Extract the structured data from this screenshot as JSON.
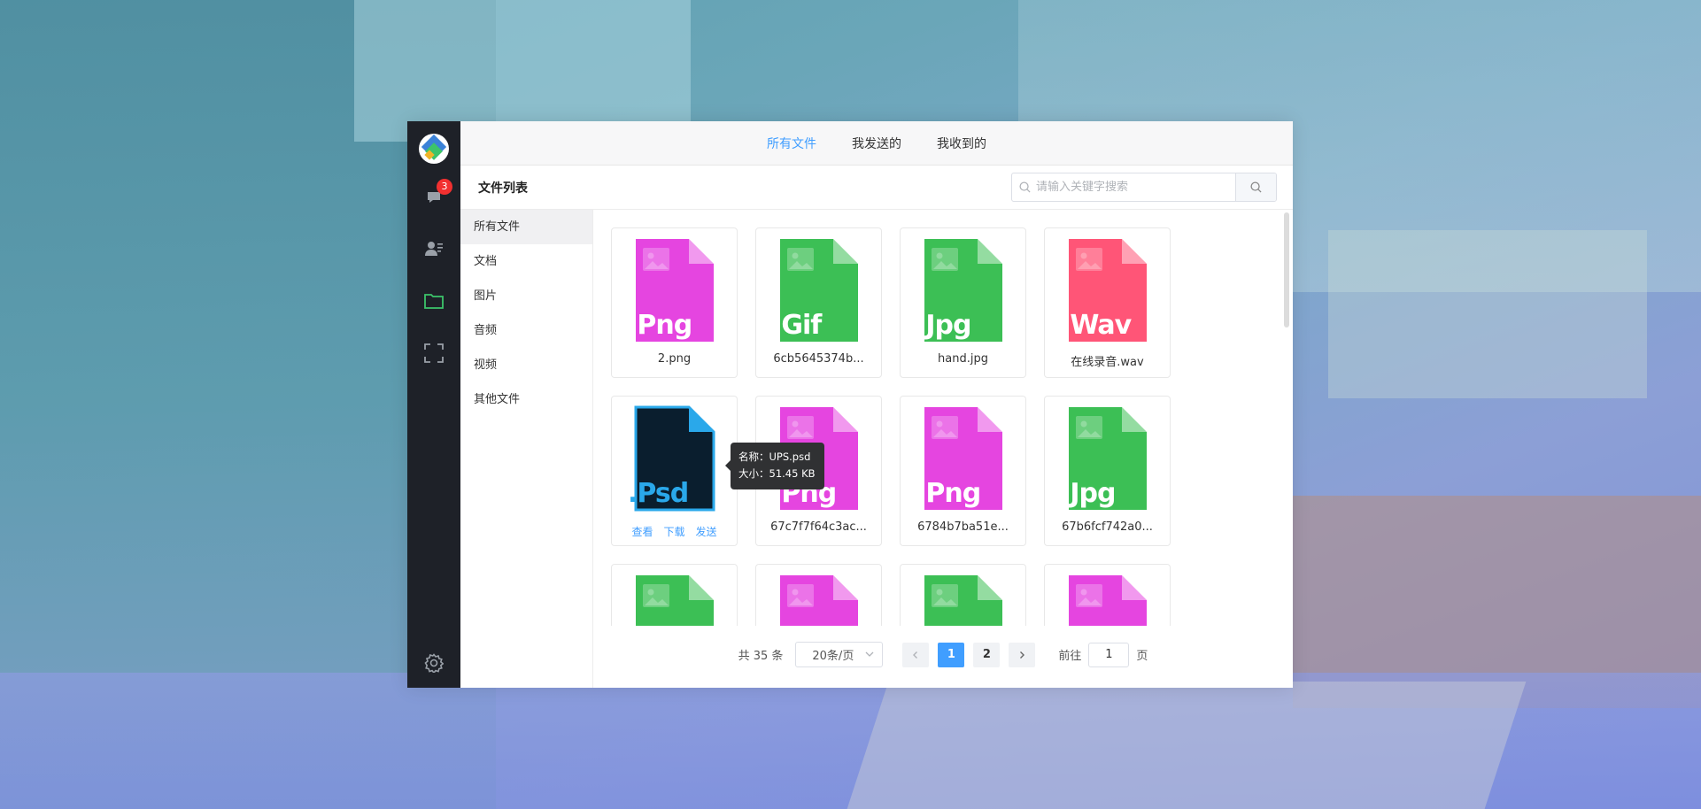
{
  "top_tabs": [
    {
      "label": "所有文件",
      "active": true
    },
    {
      "label": "我发送的",
      "active": false
    },
    {
      "label": "我收到的",
      "active": false
    }
  ],
  "sidebar": {
    "chat_badge": "3",
    "icons": [
      "app-logo",
      "chat-icon",
      "contacts-icon",
      "folder-icon",
      "fullscreen-icon",
      "settings-icon"
    ]
  },
  "list_title": "文件列表",
  "search": {
    "placeholder": "请输入关键字搜索",
    "value": ""
  },
  "categories": [
    "所有文件",
    "文档",
    "图片",
    "音频",
    "视频",
    "其他文件"
  ],
  "files": [
    {
      "name": "2.png",
      "ext": ".Png",
      "color": "#e545e0"
    },
    {
      "name": "6cb5645374b...",
      "ext": ".Gif",
      "color": "#3cbf55"
    },
    {
      "name": "hand.jpg",
      "ext": ".Jpg",
      "color": "#3cbf55"
    },
    {
      "name": "在线录音.wav",
      "ext": ".Wav",
      "color": "#ff5577"
    },
    {
      "name": "UPS.psd",
      "ext": ".Psd",
      "color": "#0a1e2e"
    },
    {
      "name": "67c7f7f64c3ac...",
      "ext": ".Png",
      "color": "#e545e0"
    },
    {
      "name": "6784b7ba51e...",
      "ext": ".Png",
      "color": "#e545e0"
    },
    {
      "name": "67b6fcf742a0...",
      "ext": ".Jpg",
      "color": "#3cbf55"
    },
    {
      "name": "",
      "ext": "",
      "color": "#3cbf55"
    },
    {
      "name": "",
      "ext": "",
      "color": "#e545e0"
    },
    {
      "name": "",
      "ext": "",
      "color": "#3cbf55"
    },
    {
      "name": "",
      "ext": "",
      "color": "#e545e0"
    }
  ],
  "hover_actions": [
    "查看",
    "下载",
    "发送"
  ],
  "tooltip": {
    "name_line": "名称：UPS.psd",
    "size_line": "大小：51.45 KB"
  },
  "pagination": {
    "total": "共 35 条",
    "page_size": "20条/页",
    "pages": [
      "1",
      "2"
    ],
    "current_page": "1",
    "goto_label": "前往",
    "goto_value": "1",
    "goto_suffix": "页"
  }
}
